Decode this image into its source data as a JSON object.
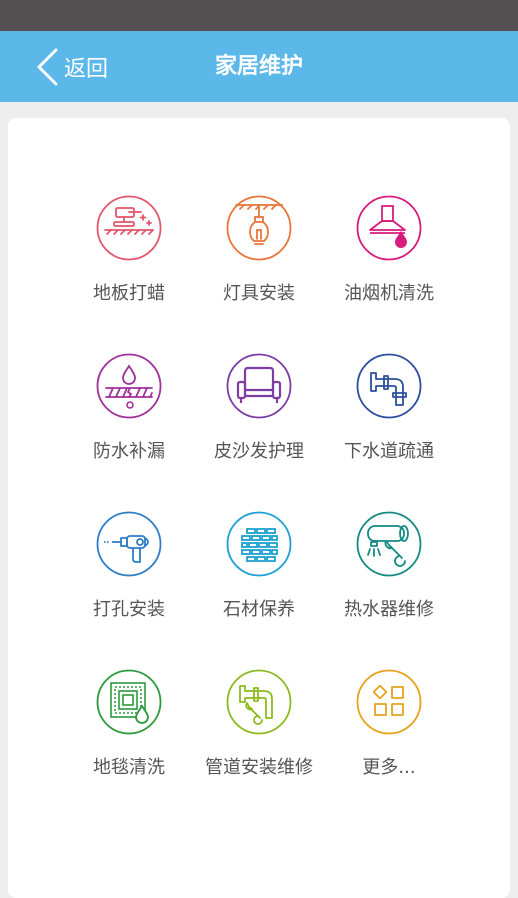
{
  "header": {
    "back_label": "返回",
    "title": "家居维护"
  },
  "colors": {
    "status_bar": "#545052",
    "nav_bar": "#5bb8e9",
    "background": "#eeeeee",
    "card": "#ffffff",
    "label": "#555555"
  },
  "services": [
    {
      "label": "地板打蜡",
      "icon": "floor-polisher-icon",
      "color": "#e2566c"
    },
    {
      "label": "灯具安装",
      "icon": "hanging-bulb-icon",
      "color": "#e8753a"
    },
    {
      "label": "油烟机清洗",
      "icon": "range-hood-icon",
      "color": "#d81b7c"
    },
    {
      "label": "防水补漏",
      "icon": "water-drop-leak-icon",
      "color": "#a0309a"
    },
    {
      "label": "皮沙发护理",
      "icon": "sofa-icon",
      "color": "#7c3da5"
    },
    {
      "label": "下水道疏通",
      "icon": "drain-pipe-icon",
      "color": "#2d4f9d"
    },
    {
      "label": "打孔安装",
      "icon": "drill-icon",
      "color": "#2e7dc8"
    },
    {
      "label": "石材保养",
      "icon": "brick-wall-icon",
      "color": "#1ba0d0"
    },
    {
      "label": "热水器维修",
      "icon": "water-heater-wrench-icon",
      "color": "#138a83"
    },
    {
      "label": "地毯清洗",
      "icon": "carpet-drop-icon",
      "color": "#2c9a3c"
    },
    {
      "label": "管道安装维修",
      "icon": "pipe-wrench-icon",
      "color": "#8cbb1f"
    },
    {
      "label": "更多...",
      "icon": "more-grid-icon",
      "color": "#e6a21a"
    }
  ]
}
